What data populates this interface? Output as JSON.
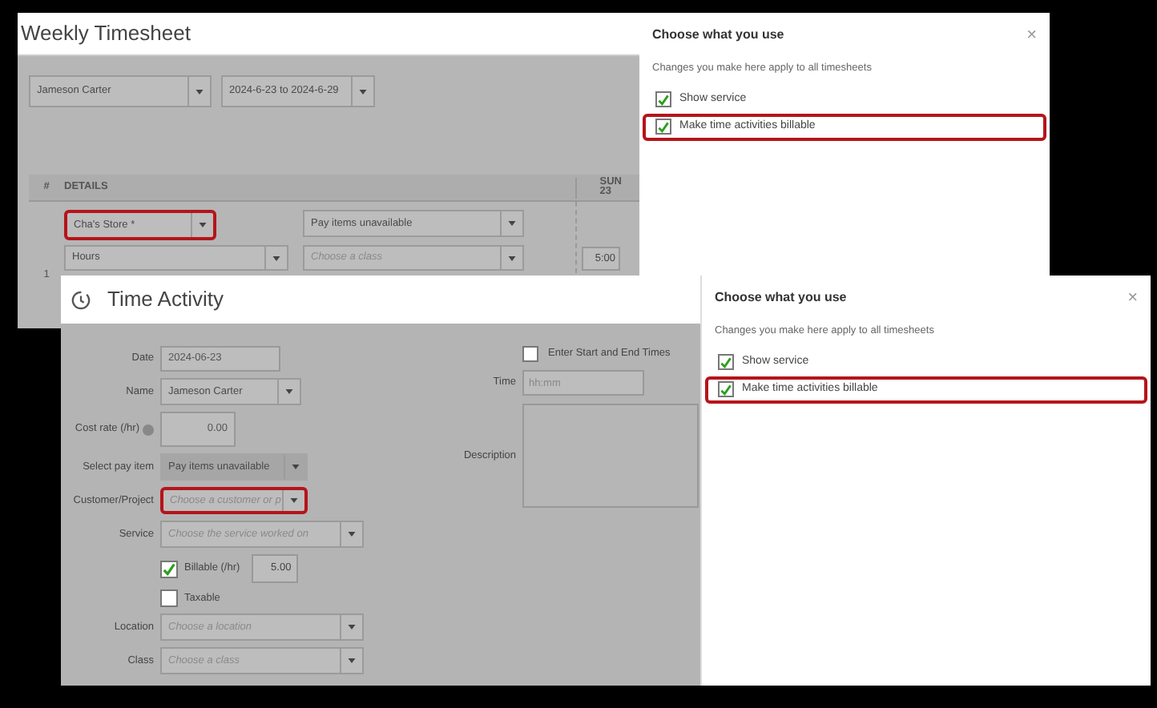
{
  "back_window": {
    "title": "Weekly Timesheet",
    "employee": {
      "value": "Jameson Carter"
    },
    "date_range": {
      "value": "2024-6-23 to 2024-6-29"
    },
    "table": {
      "columns": [
        {
          "label": "#"
        },
        {
          "label": "DETAILS"
        },
        {
          "label": "SUN",
          "sub": "23"
        }
      ],
      "rows": [
        {
          "number": "1",
          "customer": {
            "value": "Cha's Store *",
            "highlighted": true
          },
          "pay_item": {
            "value": "Pay items unavailable"
          },
          "service": {
            "value": "Hours"
          },
          "class": {
            "placeholder": "Choose a class"
          },
          "sun": "5:00"
        }
      ]
    },
    "panel": {
      "title": "Choose what you use",
      "close": "×",
      "description": "Changes you make here apply to all timesheets",
      "options": [
        {
          "label": "Show service",
          "checked": true,
          "highlighted": false
        },
        {
          "label": "Make time activities billable",
          "checked": true,
          "highlighted": true
        }
      ]
    }
  },
  "front_window": {
    "title": "Time Activity",
    "fields": [
      {
        "kind": "text",
        "label": "Date",
        "value": "2024-06-23"
      },
      {
        "kind": "select",
        "label": "Name",
        "value": "Jameson Carter",
        "highlighted": false,
        "disabled": false
      },
      {
        "kind": "number",
        "label": "Cost rate (/hr)",
        "value": "0.00",
        "info": true
      },
      {
        "kind": "select",
        "label": "Select pay item",
        "value": "Pay items unavailable",
        "highlighted": false,
        "disabled": true
      },
      {
        "kind": "select",
        "label": "Customer/Project",
        "placeholder": "Choose a customer or p",
        "highlighted": true,
        "disabled": false
      },
      {
        "kind": "select",
        "label": "Service",
        "placeholder": "Choose the service worked on",
        "highlighted": false,
        "disabled": false
      },
      {
        "kind": "checkbox",
        "label": "Billable (/hr)",
        "checked": true,
        "value": "5.00"
      },
      {
        "kind": "checkbox",
        "label": "Taxable",
        "checked": false
      },
      {
        "kind": "select",
        "label": "Location",
        "placeholder": "Choose a location",
        "highlighted": false,
        "disabled": false
      },
      {
        "kind": "select",
        "label": "Class",
        "placeholder": "Choose a class",
        "highlighted": false,
        "disabled": false
      }
    ],
    "start_end": {
      "label": "Enter Start and End Times",
      "checked": false
    },
    "time": {
      "label": "Time",
      "placeholder": "hh:mm"
    },
    "description": {
      "label": "Description"
    },
    "panel": {
      "title": "Choose what you use",
      "close": "×",
      "description": "Changes you make here apply to all timesheets",
      "options": [
        {
          "label": "Show service",
          "checked": true,
          "highlighted": false
        },
        {
          "label": "Make time activities billable",
          "checked": true,
          "highlighted": true
        }
      ]
    }
  }
}
